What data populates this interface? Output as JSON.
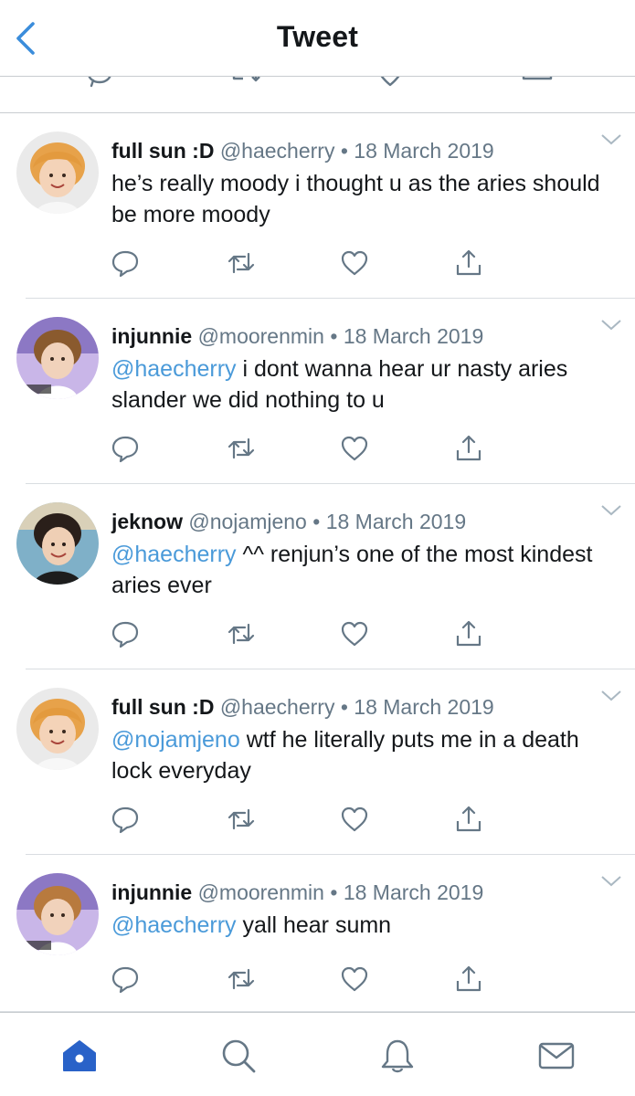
{
  "header": {
    "title": "Tweet",
    "back_icon": "chevron-left-icon",
    "accent": "#3b8ddb"
  },
  "colors": {
    "mention": "#4a9ad9",
    "secondary": "#657786",
    "icon": "#657786",
    "tab_active": "#2962c8"
  },
  "tweets": [
    {
      "name": "full sun :D",
      "handle": "@haecherry",
      "sep": "•",
      "date": "18 March 2019",
      "mention": "",
      "text": "he’s really moody i thought u as the aries should be more moody"
    },
    {
      "name": "injunnie",
      "handle": "@moorenmin",
      "sep": "•",
      "date": "18 March 2019",
      "mention": "@haecherry",
      "text": " i dont wanna hear ur nasty aries slander we did nothing to u"
    },
    {
      "name": "jeknow",
      "handle": "@nojamjeno",
      "sep": "•",
      "date": "18 March 2019",
      "mention": "@haecherry",
      "text": " ^^ renjun’s one of the most kindest aries ever"
    },
    {
      "name": "full sun :D",
      "handle": "@haecherry",
      "sep": "•",
      "date": "18 March 2019",
      "mention": "@nojamjeno",
      "text": " wtf he literally puts me in a death lock everyday"
    },
    {
      "name": "injunnie",
      "handle": "@moorenmin",
      "sep": "•",
      "date": "18 March 2019",
      "mention": "@haecherry",
      "text": " yall hear sumn"
    }
  ],
  "tweet_actions": [
    "reply-icon",
    "retweet-icon",
    "like-icon",
    "share-icon"
  ],
  "tabbar": {
    "items": [
      "home-icon",
      "search-icon",
      "notifications-icon",
      "messages-icon"
    ],
    "active": "home-icon"
  }
}
